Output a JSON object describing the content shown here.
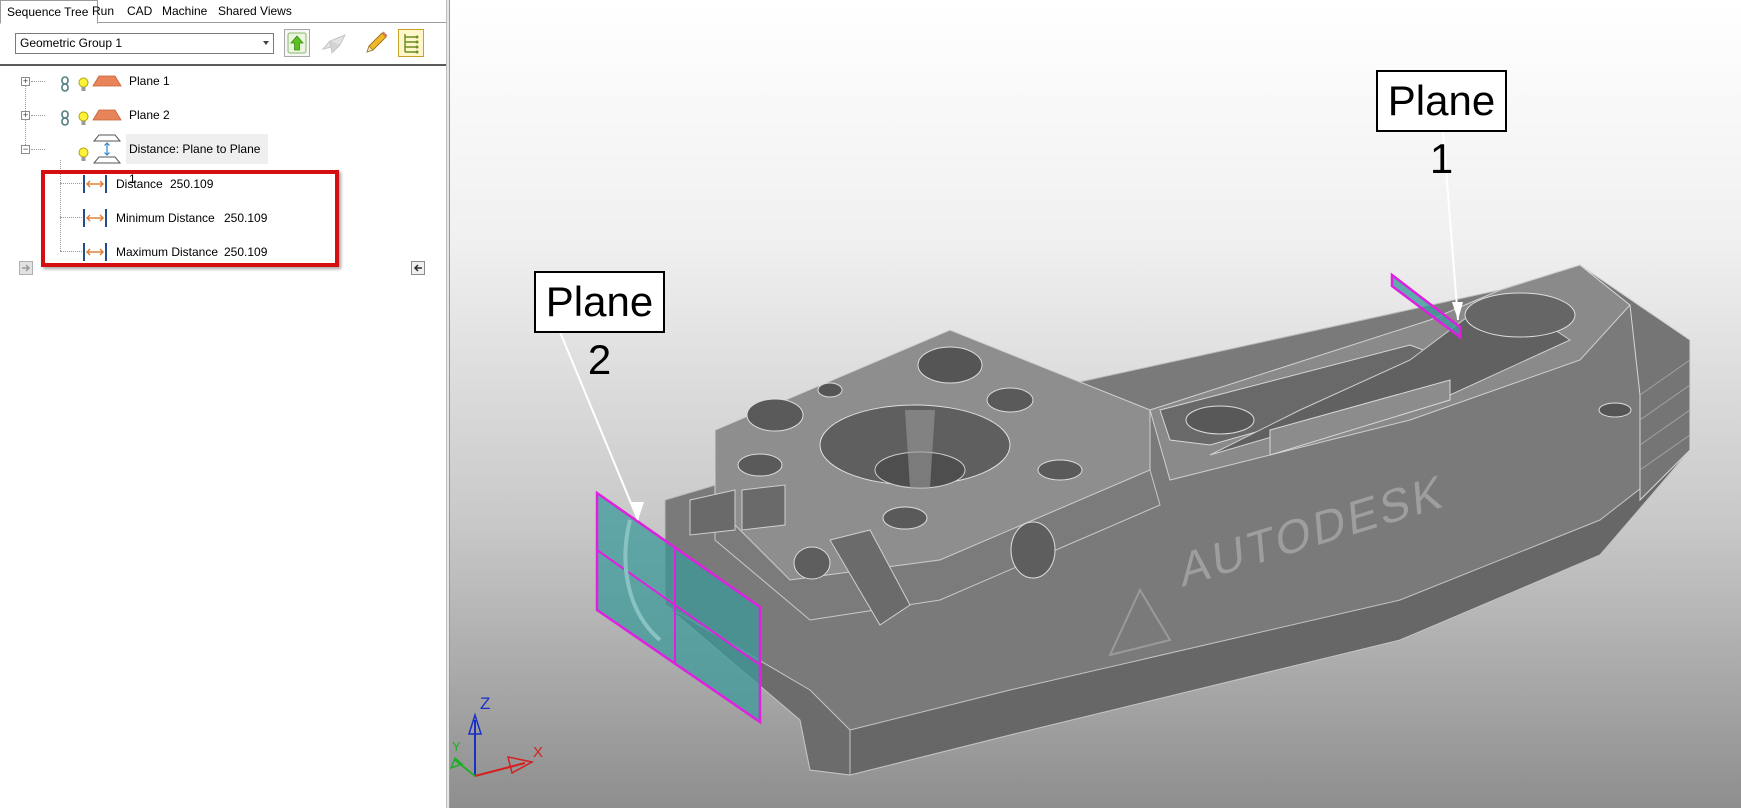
{
  "tabs": [
    {
      "label": "Sequence Tree",
      "active": true
    },
    {
      "label": "Run",
      "active": false
    },
    {
      "label": "CAD",
      "active": false
    },
    {
      "label": "Machine",
      "active": false
    },
    {
      "label": "Shared Views",
      "active": false
    }
  ],
  "toolbar": {
    "group_select_value": "Geometric Group 1",
    "icons": [
      "up-arrow-icon",
      "surface-icon",
      "pencil-icon",
      "tree-list-icon"
    ]
  },
  "tree": {
    "items": [
      {
        "label": "Plane 1",
        "icons": [
          "link-icon",
          "lightbulb-icon",
          "plane-icon"
        ]
      },
      {
        "label": "Plane 2",
        "icons": [
          "link-icon",
          "lightbulb-icon",
          "plane-icon"
        ]
      },
      {
        "label": "Distance: Plane to Plane 1",
        "icons": [
          "lightbulb-icon",
          "distance-planes-icon"
        ],
        "selected": true
      }
    ],
    "children": [
      {
        "label": "Distance",
        "value": "250.109"
      },
      {
        "label": "Minimum Distance",
        "value": "250.109"
      },
      {
        "label": "Maximum Distance",
        "value": "250.109"
      }
    ]
  },
  "viewport": {
    "callout_plane1": "Plane 1",
    "callout_plane2": "Plane 2",
    "brand_text": "AUTODESK",
    "axes": {
      "x": "X",
      "y": "Y",
      "z": "Z"
    }
  },
  "colors": {
    "highlight_border": "#d50f0f",
    "plane_selection": "#e020e0",
    "plane_fill": "#3c9a9a",
    "plane_icon": "#e8845a",
    "model_grey": "#7d7d7d"
  }
}
